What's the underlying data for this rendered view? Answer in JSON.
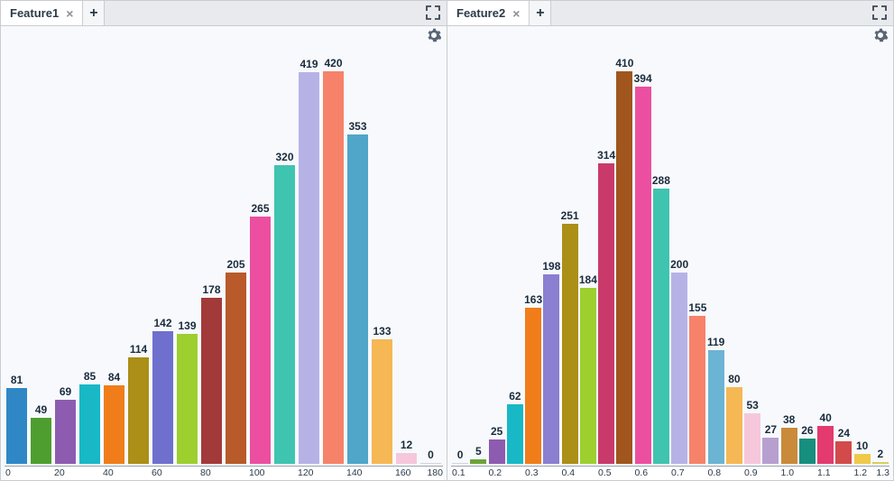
{
  "panels": [
    {
      "tab_label": "Feature1",
      "chart_index": 0
    },
    {
      "tab_label": "Feature2",
      "chart_index": 1
    }
  ],
  "chart_data": [
    {
      "type": "bar",
      "title": "Feature1",
      "xlabel": "",
      "ylabel": "",
      "ylim": [
        0,
        420
      ],
      "x_ticks": [
        "0",
        "20",
        "40",
        "60",
        "80",
        "100",
        "120",
        "140",
        "160",
        "180"
      ],
      "categories": [
        "0-10",
        "10-20",
        "20-30",
        "30-40",
        "40-50",
        "50-60",
        "60-70",
        "70-80",
        "80-90",
        "90-100",
        "100-110",
        "110-120",
        "120-130",
        "130-140",
        "140-150",
        "150-160",
        "160-170",
        "170-180"
      ],
      "values": [
        81,
        49,
        69,
        85,
        84,
        114,
        142,
        139,
        178,
        205,
        265,
        320,
        419,
        420,
        353,
        133,
        12,
        0
      ],
      "colors": [
        "#2f88c5",
        "#4e9e2f",
        "#8d5bb0",
        "#18b8c6",
        "#f07d1a",
        "#ab8f17",
        "#6f6fce",
        "#9dcf2f",
        "#a33a3a",
        "#b85a2a",
        "#ec4fa0",
        "#3fc4b0",
        "#b7b2e6",
        "#f6826a",
        "#4fa6c9",
        "#f6b755",
        "#f6c7da",
        "#cfd5dc"
      ]
    },
    {
      "type": "bar",
      "title": "Feature2",
      "xlabel": "",
      "ylabel": "",
      "ylim": [
        0,
        410
      ],
      "x_ticks": [
        "0.1",
        "0.2",
        "0.3",
        "0.4",
        "0.5",
        "0.6",
        "0.7",
        "0.8",
        "0.9",
        "1.0",
        "1.1",
        "1.2",
        "1.3"
      ],
      "categories": [
        "0.10-0.15",
        "0.15-0.20",
        "0.20-0.25",
        "0.25-0.30",
        "0.30-0.35",
        "0.35-0.40",
        "0.40-0.45",
        "0.45-0.50",
        "0.50-0.55",
        "0.55-0.60",
        "0.60-0.65",
        "0.65-0.70",
        "0.70-0.75",
        "0.75-0.80",
        "0.80-0.85",
        "0.85-0.90",
        "0.90-0.95",
        "0.95-1.00",
        "1.00-1.05",
        "1.05-1.10",
        "1.10-1.15",
        "1.15-1.20",
        "1.20-1.25",
        "1.25-1.30"
      ],
      "values": [
        0,
        5,
        25,
        62,
        163,
        198,
        251,
        184,
        314,
        410,
        394,
        288,
        200,
        155,
        119,
        80,
        53,
        27,
        38,
        26,
        40,
        24,
        10,
        2
      ],
      "colors": [
        "#cfd5dc",
        "#6da33a",
        "#8d5bb0",
        "#18b8c6",
        "#f07d1a",
        "#8a7fd0",
        "#ab8f17",
        "#9dcf2f",
        "#c93a6a",
        "#a0561d",
        "#ec4fa0",
        "#3fc4b0",
        "#b7b2e6",
        "#f6826a",
        "#6bb4d3",
        "#f6b755",
        "#f6c7da",
        "#b79fd0",
        "#c98a3a",
        "#168f7e",
        "#e33a6f",
        "#d34a4a",
        "#efc94a",
        "#d6d15a"
      ]
    }
  ]
}
